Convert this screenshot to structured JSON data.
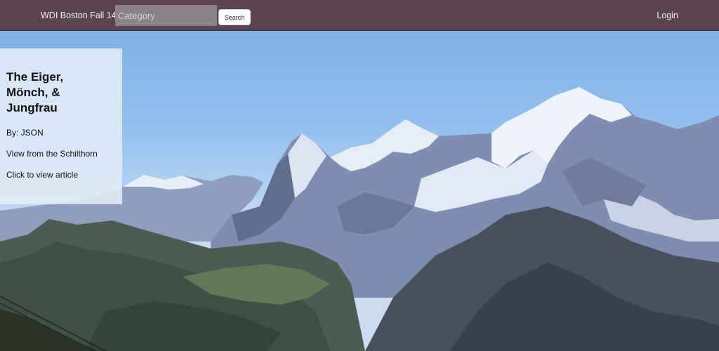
{
  "nav": {
    "brand": "WDI Boston Fall 14",
    "search_placeholder": "Category",
    "search_button": "Search",
    "login": "Login"
  },
  "card": {
    "title": "The Eiger, Mönch, & Jungfrau",
    "author": "By: JSON",
    "description": "View from the Schilthorn",
    "link": "Click to view article"
  },
  "colors": {
    "navbar": "#5a4452",
    "card_background": "#e4ecf7"
  }
}
